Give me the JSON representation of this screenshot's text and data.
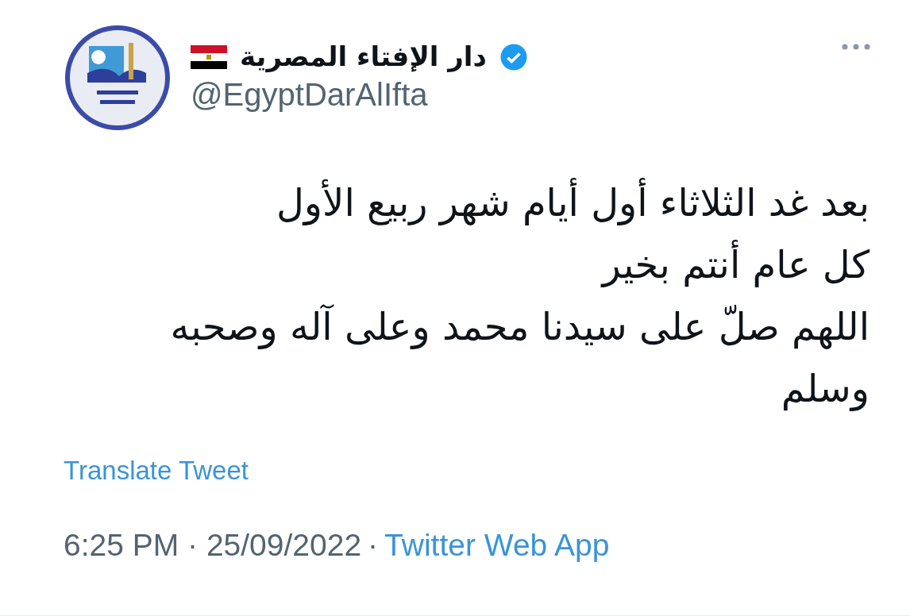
{
  "tweet": {
    "author": {
      "name": "دار الإفتاء المصرية",
      "verified": true,
      "handle": "@EgyptDarAlIfta"
    },
    "text": "بعد غد الثلاثاء أول أيام شهر ربيع الأول\nكل عام أنتم بخير\nاللهم صلّ على سيدنا محمد وعلى آله وصحبه وسلم",
    "translate_link": "Translate Tweet",
    "meta": {
      "timestamp": "6:25 PM · 25/09/2022",
      "separator": "·",
      "source": "Twitter Web App"
    }
  }
}
